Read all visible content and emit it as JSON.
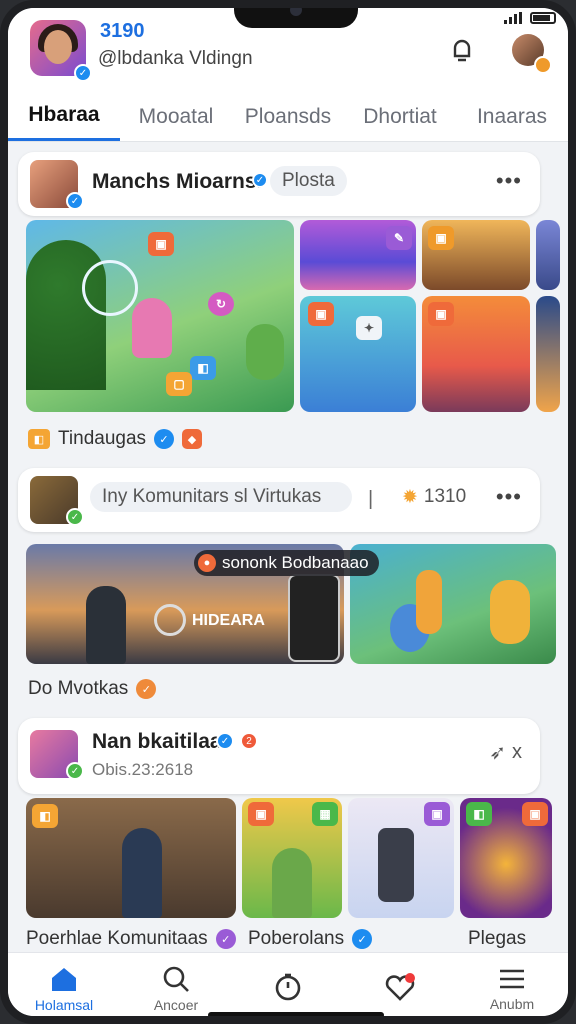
{
  "status": {
    "battery_icon": "battery-icon",
    "signal_icon": "signal-icon"
  },
  "header": {
    "count": "3190",
    "handle": "@lbdanka Vldingn",
    "notification_icon": "bell-icon"
  },
  "tabs": [
    {
      "label": "Hbaraa",
      "active": true
    },
    {
      "label": "Mooatal",
      "active": false
    },
    {
      "label": "Ploansds",
      "active": false
    },
    {
      "label": "Dhortiat",
      "active": false
    },
    {
      "label": "Inaaras",
      "active": false
    }
  ],
  "post1": {
    "title": "Manchs Mioarnsi",
    "tag": "Plosta",
    "more": "•••",
    "caption": "Tindaugas"
  },
  "community": {
    "text": "Iny Komunitars sl Virtukas",
    "count": "1310",
    "more": "•••"
  },
  "video": {
    "overlay": "sononk Bodbanaao",
    "inner": "HIDEARA",
    "caption": "Do Mvotkas"
  },
  "post3": {
    "title": "Nan bkaitilaa",
    "subtitle": "Obis.23:2618",
    "pin_label": "x"
  },
  "grid_captions": [
    "Poerhlae Komunitaas",
    "Poberolans",
    "Plegas"
  ],
  "bottom_nav": [
    {
      "label": "Holamsal",
      "icon": "home-icon",
      "active": true
    },
    {
      "label": "Ancoer",
      "icon": "search-icon",
      "active": false
    },
    {
      "label": "",
      "icon": "timer-icon",
      "active": false
    },
    {
      "label": "",
      "icon": "notification-heart-icon",
      "active": false
    },
    {
      "label": "Anubm",
      "icon": "menu-icon",
      "active": false
    }
  ],
  "colors": {
    "accent": "#1d6fe0",
    "badge_orange": "#ef6a3a",
    "badge_purple": "#9a5bd6"
  }
}
